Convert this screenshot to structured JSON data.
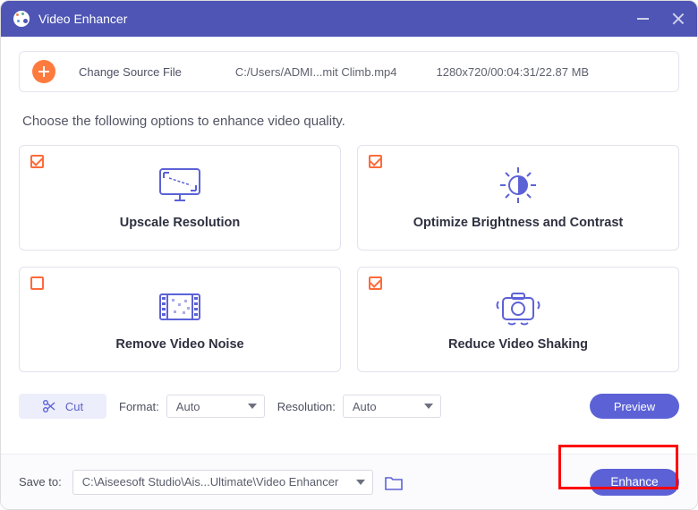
{
  "title": "Video Enhancer",
  "source": {
    "change_label": "Change Source File",
    "path": "C:/Users/ADMI...mit Climb.mp4",
    "meta": "1280x720/00:04:31/22.87 MB"
  },
  "instruction": "Choose the following options to enhance video quality.",
  "cards": {
    "upscale": {
      "label": "Upscale Resolution",
      "checked": true
    },
    "brightness": {
      "label": "Optimize Brightness and Contrast",
      "checked": true
    },
    "noise": {
      "label": "Remove Video Noise",
      "checked": false
    },
    "shaking": {
      "label": "Reduce Video Shaking",
      "checked": true
    }
  },
  "controls": {
    "cut_label": "Cut",
    "format_label": "Format:",
    "format_value": "Auto",
    "resolution_label": "Resolution:",
    "resolution_value": "Auto",
    "preview_label": "Preview"
  },
  "footer": {
    "save_label": "Save to:",
    "save_path": "C:\\Aiseesoft Studio\\Ais...Ultimate\\Video Enhancer",
    "enhance_label": "Enhance"
  }
}
